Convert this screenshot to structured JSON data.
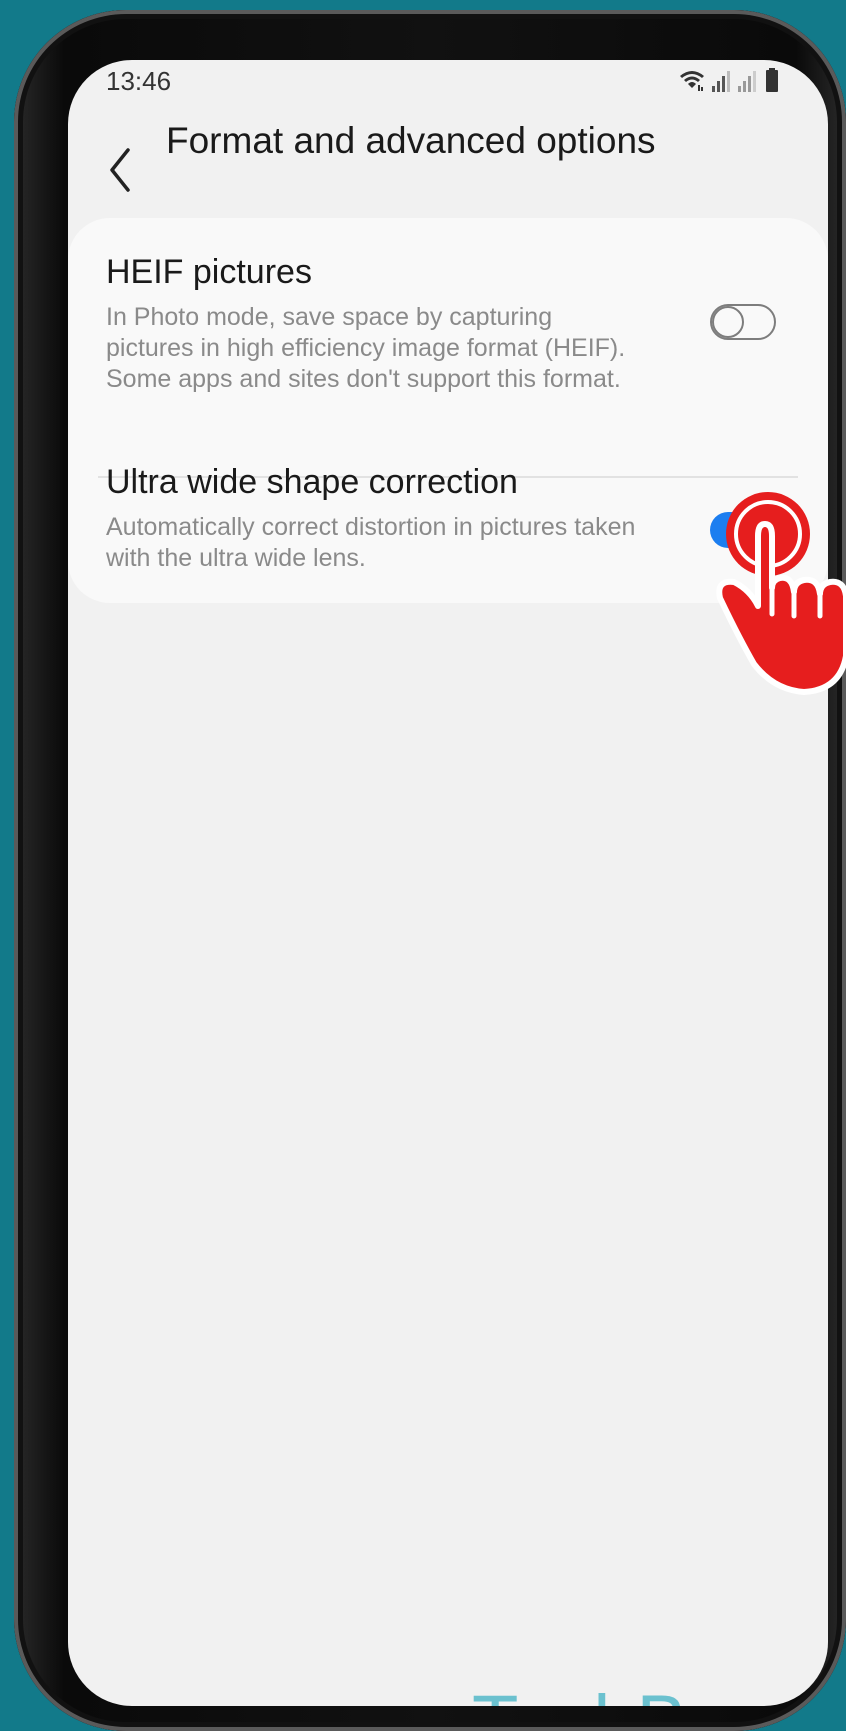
{
  "status_bar": {
    "time": "13:46",
    "icons": [
      "wifi-icon",
      "signal-icon",
      "signal-icon",
      "battery-icon"
    ]
  },
  "header": {
    "title": "Format and advanced options",
    "back_icon": "chevron-left-icon"
  },
  "settings": [
    {
      "title": "HEIF pictures",
      "description": "In Photo mode, save space by capturing pictures in high efficiency image format (HEIF). Some apps and sites don't support this format.",
      "toggle_on": false
    },
    {
      "title": "Ultra wide shape correction",
      "description": "Automatically correct distortion in pictures taken with the ultra wide lens.",
      "toggle_on": true
    }
  ],
  "watermark": "TechBone",
  "colors": {
    "background": "#127a8a",
    "screen": "#f1f1f1",
    "card": "#f9f9f9",
    "accent": "#1c7ef0",
    "tap_indicator": "#e61e1e",
    "watermark": "#6bc1cf"
  }
}
